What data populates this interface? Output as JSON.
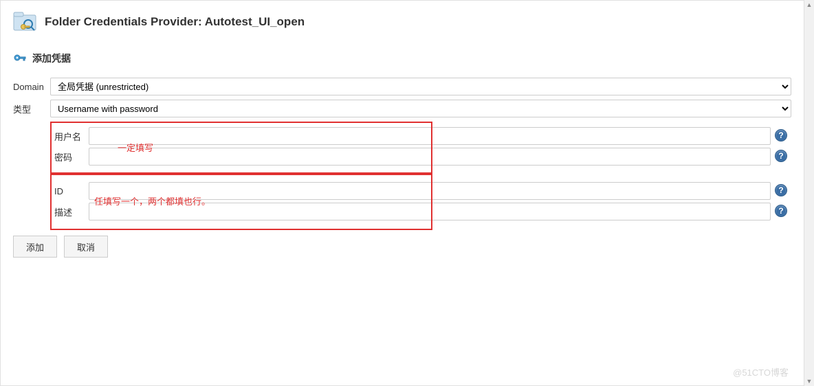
{
  "header": {
    "title": "Folder Credentials Provider: Autotest_UI_open"
  },
  "section": {
    "add_credentials": "添加凭据"
  },
  "form": {
    "domain_label": "Domain",
    "domain_value": "全局凭据 (unrestricted)",
    "type_label": "类型",
    "type_value": "Username with password",
    "username_label": "用户名",
    "username_value": "",
    "password_label": "密码",
    "password_value": "",
    "id_label": "ID",
    "id_value": "",
    "desc_label": "描述",
    "desc_value": ""
  },
  "annotations": {
    "must_fill": "一定填写",
    "either_fill": "任填写一个，两个都填也行。"
  },
  "buttons": {
    "add": "添加",
    "cancel": "取消"
  },
  "watermark": "@51CTO博客"
}
